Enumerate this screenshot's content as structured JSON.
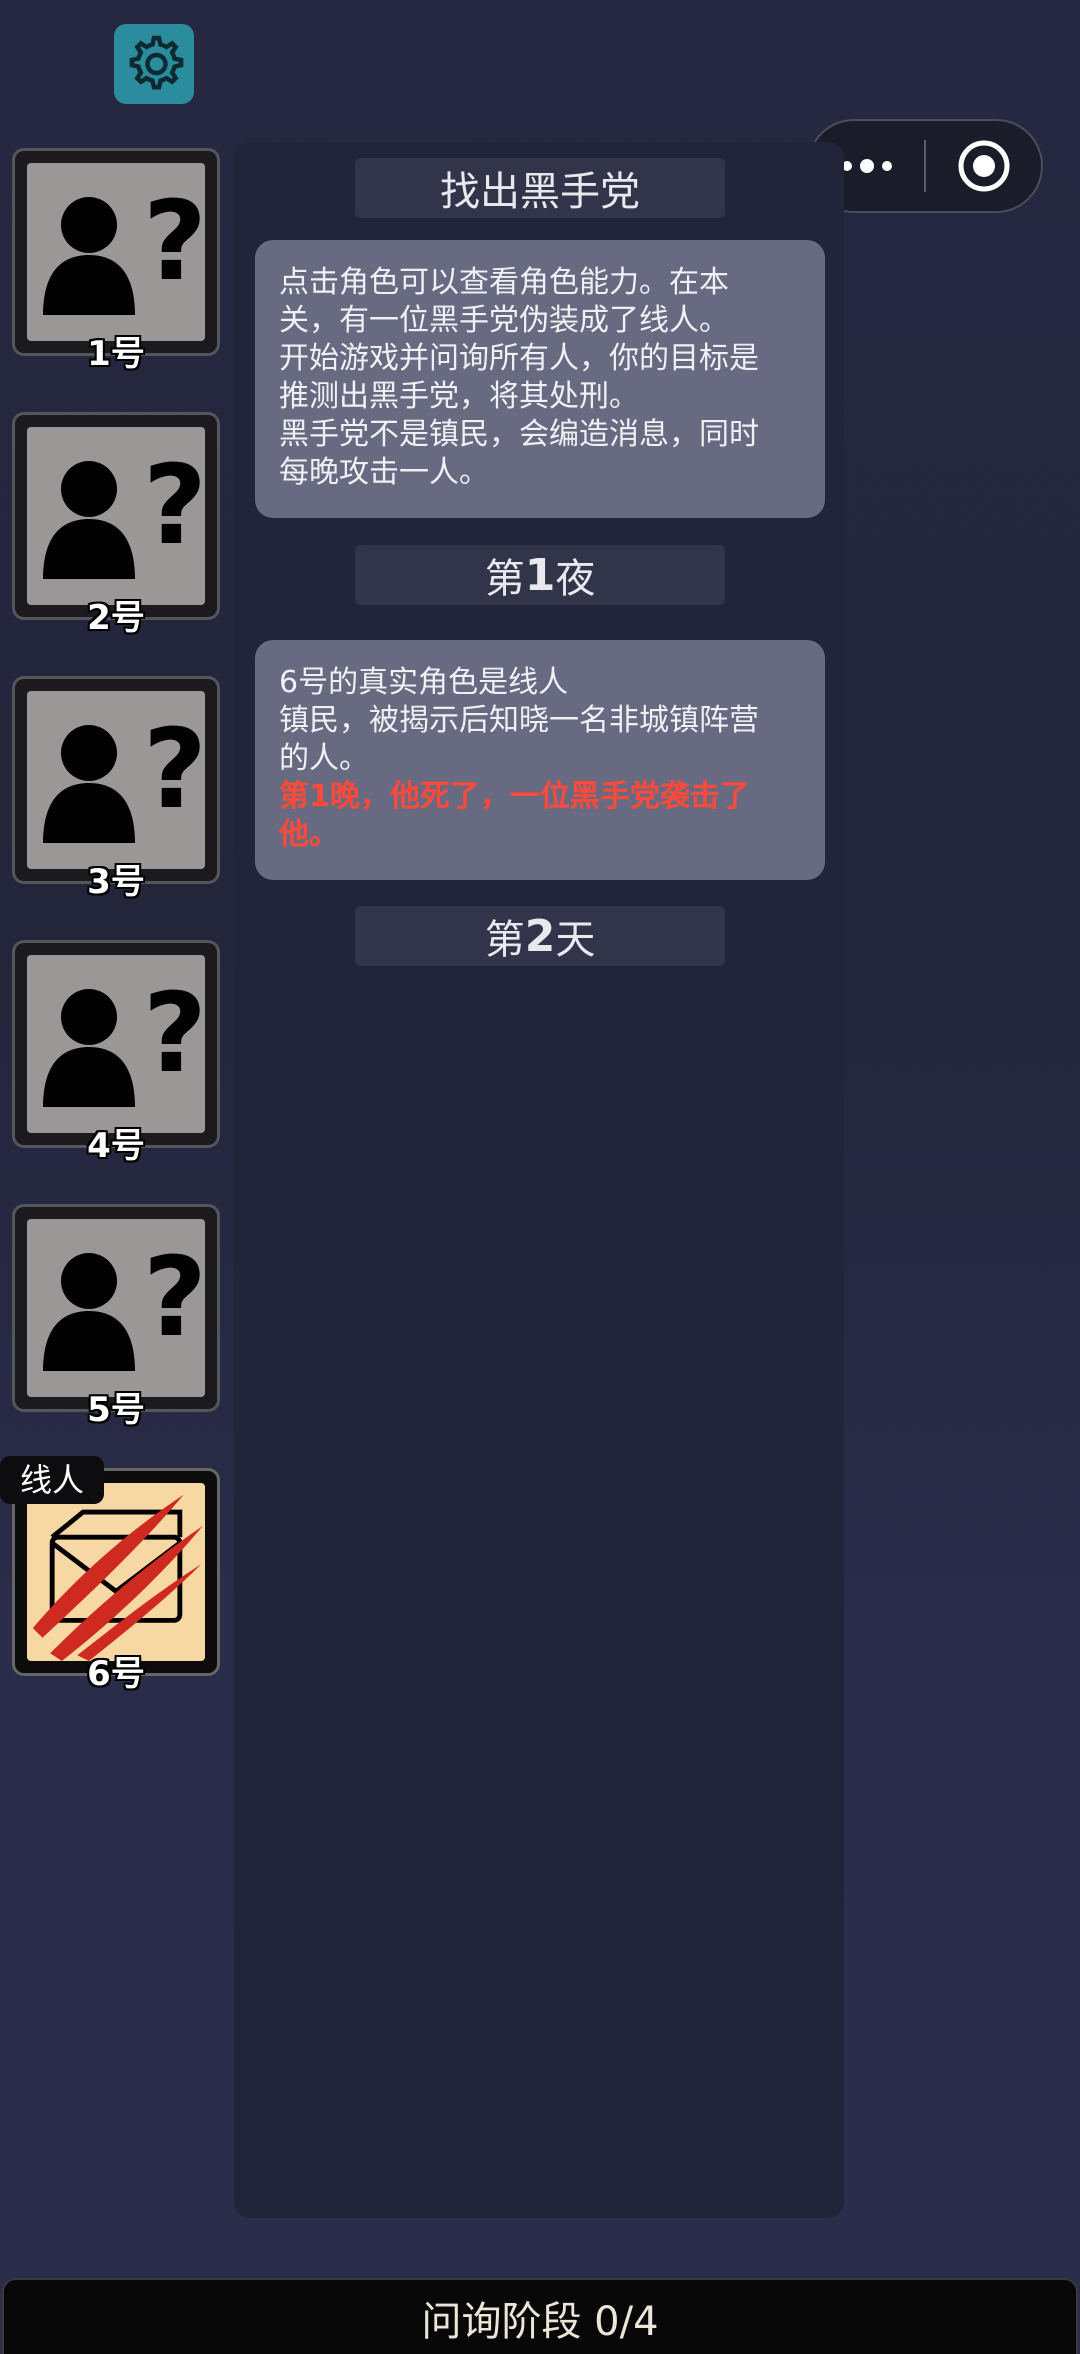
{
  "icons": {
    "settings": "gear-icon",
    "more": "more-dots-icon",
    "close": "target-icon",
    "unknown": "person-question-icon",
    "revealed": "envelope-scratched-icon"
  },
  "players": [
    {
      "label": "1号"
    },
    {
      "label": "2号"
    },
    {
      "label": "3号"
    },
    {
      "label": "4号"
    },
    {
      "label": "5号"
    },
    {
      "label": "6号",
      "role": "线人"
    }
  ],
  "log": {
    "title": "找出黑手党",
    "intro": [
      "点击角色可以查看角色能力。在本",
      "关，有一位黑手党伪装成了线人。",
      "开始游戏并问询所有人，你的目标是",
      "推测出黑手党，将其处刑。",
      "黑手党不是镇民，会编造消息，同时",
      "每晚攻击一人。"
    ],
    "night1": {
      "prefix": "第",
      "num": "1",
      "suffix": "夜"
    },
    "reveal": {
      "line1": "6号的真实角色是线人",
      "line2": [
        "镇民，被揭示后知晓一名非城镇阵营",
        "的人。"
      ],
      "red": [
        "第1晚，他死了，一位黑手党袭击了",
        "他。"
      ]
    },
    "day2": {
      "prefix": "第",
      "num": "2",
      "suffix": "天"
    }
  },
  "status": {
    "phase": "问询阶段 0/4"
  },
  "colors": {
    "accent_teal": "#2a8c9c",
    "alert_red": "#ff4a3a",
    "revealed_card": "#f7d7a4"
  }
}
